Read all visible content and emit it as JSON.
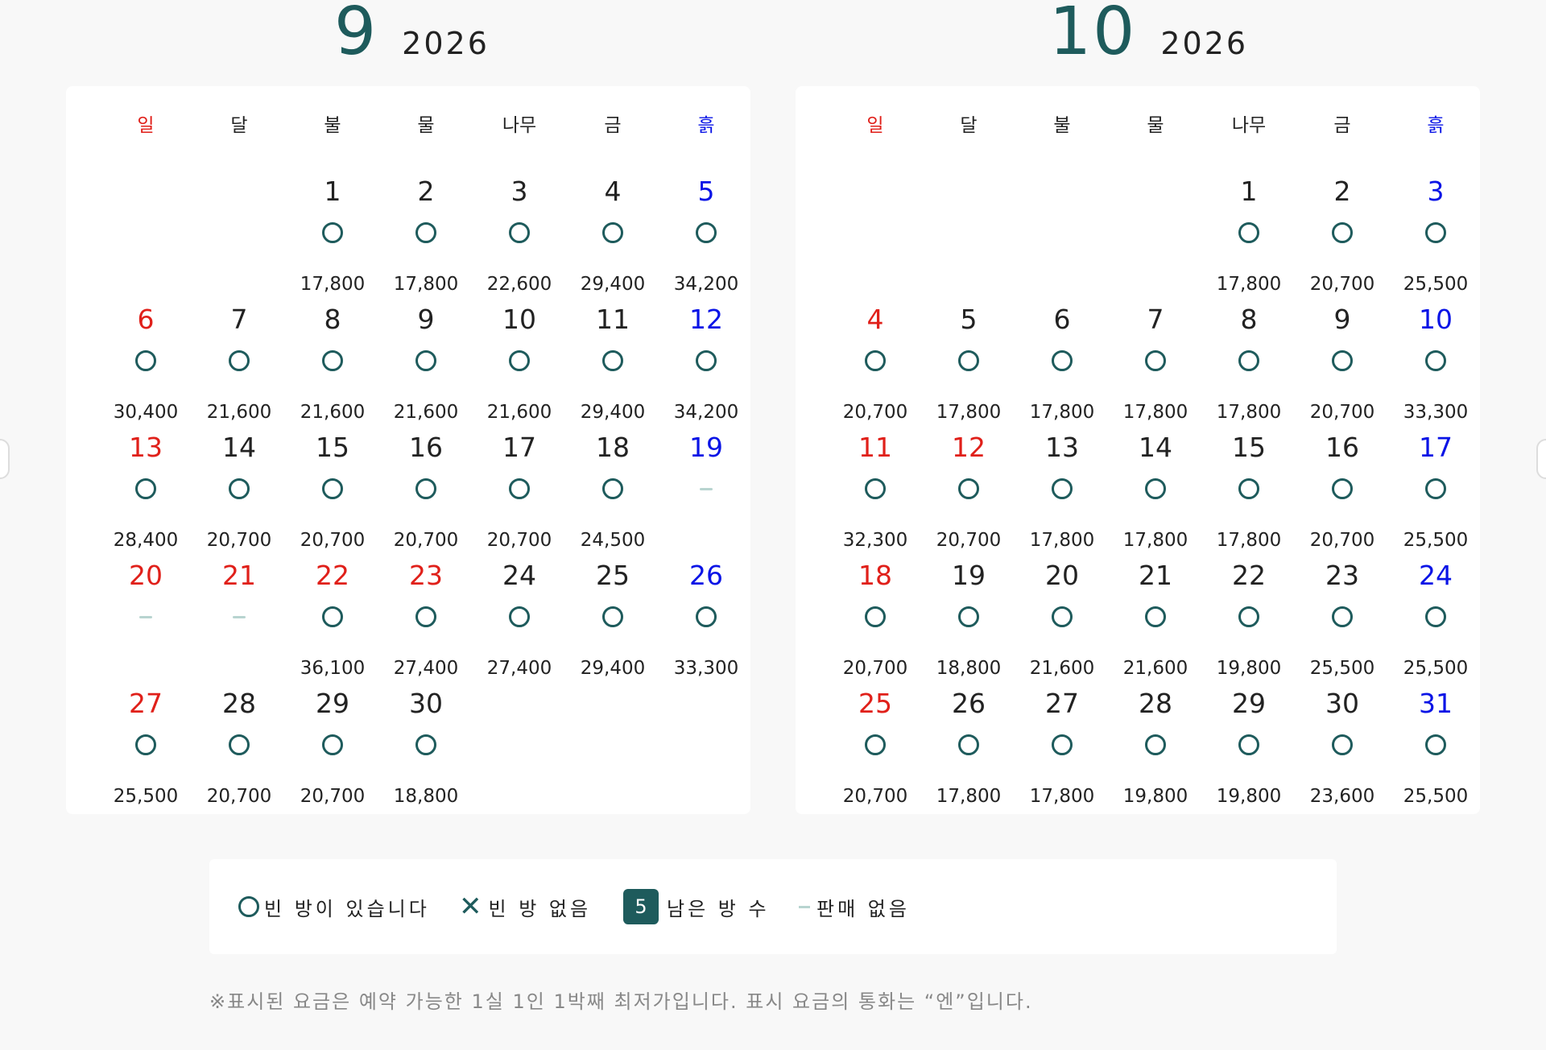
{
  "weekdays": [
    "일",
    "달",
    "불",
    "물",
    "나무",
    "금",
    "흙"
  ],
  "months": [
    {
      "month": "9",
      "year": "2026",
      "days": [
        {
          "d": "1",
          "col": 2,
          "row": 0,
          "c": "n",
          "m": "o",
          "p": "17,800"
        },
        {
          "d": "2",
          "col": 3,
          "row": 0,
          "c": "n",
          "m": "o",
          "p": "17,800"
        },
        {
          "d": "3",
          "col": 4,
          "row": 0,
          "c": "n",
          "m": "o",
          "p": "22,600"
        },
        {
          "d": "4",
          "col": 5,
          "row": 0,
          "c": "n",
          "m": "o",
          "p": "29,400"
        },
        {
          "d": "5",
          "col": 6,
          "row": 0,
          "c": "b",
          "m": "o",
          "p": "34,200"
        },
        {
          "d": "6",
          "col": 0,
          "row": 1,
          "c": "r",
          "m": "o",
          "p": "30,400"
        },
        {
          "d": "7",
          "col": 1,
          "row": 1,
          "c": "n",
          "m": "o",
          "p": "21,600"
        },
        {
          "d": "8",
          "col": 2,
          "row": 1,
          "c": "n",
          "m": "o",
          "p": "21,600"
        },
        {
          "d": "9",
          "col": 3,
          "row": 1,
          "c": "n",
          "m": "o",
          "p": "21,600"
        },
        {
          "d": "10",
          "col": 4,
          "row": 1,
          "c": "n",
          "m": "o",
          "p": "21,600"
        },
        {
          "d": "11",
          "col": 5,
          "row": 1,
          "c": "n",
          "m": "o",
          "p": "29,400"
        },
        {
          "d": "12",
          "col": 6,
          "row": 1,
          "c": "b",
          "m": "o",
          "p": "34,200"
        },
        {
          "d": "13",
          "col": 0,
          "row": 2,
          "c": "r",
          "m": "o",
          "p": "28,400"
        },
        {
          "d": "14",
          "col": 1,
          "row": 2,
          "c": "n",
          "m": "o",
          "p": "20,700"
        },
        {
          "d": "15",
          "col": 2,
          "row": 2,
          "c": "n",
          "m": "o",
          "p": "20,700"
        },
        {
          "d": "16",
          "col": 3,
          "row": 2,
          "c": "n",
          "m": "o",
          "p": "20,700"
        },
        {
          "d": "17",
          "col": 4,
          "row": 2,
          "c": "n",
          "m": "o",
          "p": "20,700"
        },
        {
          "d": "18",
          "col": 5,
          "row": 2,
          "c": "n",
          "m": "o",
          "p": "24,500"
        },
        {
          "d": "19",
          "col": 6,
          "row": 2,
          "c": "b",
          "m": "-",
          "p": ""
        },
        {
          "d": "20",
          "col": 0,
          "row": 3,
          "c": "r",
          "m": "-",
          "p": ""
        },
        {
          "d": "21",
          "col": 1,
          "row": 3,
          "c": "r",
          "m": "-",
          "p": ""
        },
        {
          "d": "22",
          "col": 2,
          "row": 3,
          "c": "r",
          "m": "o",
          "p": "36,100"
        },
        {
          "d": "23",
          "col": 3,
          "row": 3,
          "c": "r",
          "m": "o",
          "p": "27,400"
        },
        {
          "d": "24",
          "col": 4,
          "row": 3,
          "c": "n",
          "m": "o",
          "p": "27,400"
        },
        {
          "d": "25",
          "col": 5,
          "row": 3,
          "c": "n",
          "m": "o",
          "p": "29,400"
        },
        {
          "d": "26",
          "col": 6,
          "row": 3,
          "c": "b",
          "m": "o",
          "p": "33,300"
        },
        {
          "d": "27",
          "col": 0,
          "row": 4,
          "c": "r",
          "m": "o",
          "p": "25,500"
        },
        {
          "d": "28",
          "col": 1,
          "row": 4,
          "c": "n",
          "m": "o",
          "p": "20,700"
        },
        {
          "d": "29",
          "col": 2,
          "row": 4,
          "c": "n",
          "m": "o",
          "p": "20,700"
        },
        {
          "d": "30",
          "col": 3,
          "row": 4,
          "c": "n",
          "m": "o",
          "p": "18,800"
        }
      ]
    },
    {
      "month": "10",
      "year": "2026",
      "days": [
        {
          "d": "1",
          "col": 4,
          "row": 0,
          "c": "n",
          "m": "o",
          "p": "17,800"
        },
        {
          "d": "2",
          "col": 5,
          "row": 0,
          "c": "n",
          "m": "o",
          "p": "20,700"
        },
        {
          "d": "3",
          "col": 6,
          "row": 0,
          "c": "b",
          "m": "o",
          "p": "25,500"
        },
        {
          "d": "4",
          "col": 0,
          "row": 1,
          "c": "r",
          "m": "o",
          "p": "20,700"
        },
        {
          "d": "5",
          "col": 1,
          "row": 1,
          "c": "n",
          "m": "o",
          "p": "17,800"
        },
        {
          "d": "6",
          "col": 2,
          "row": 1,
          "c": "n",
          "m": "o",
          "p": "17,800"
        },
        {
          "d": "7",
          "col": 3,
          "row": 1,
          "c": "n",
          "m": "o",
          "p": "17,800"
        },
        {
          "d": "8",
          "col": 4,
          "row": 1,
          "c": "n",
          "m": "o",
          "p": "17,800"
        },
        {
          "d": "9",
          "col": 5,
          "row": 1,
          "c": "n",
          "m": "o",
          "p": "20,700"
        },
        {
          "d": "10",
          "col": 6,
          "row": 1,
          "c": "b",
          "m": "o",
          "p": "33,300"
        },
        {
          "d": "11",
          "col": 0,
          "row": 2,
          "c": "r",
          "m": "o",
          "p": "32,300"
        },
        {
          "d": "12",
          "col": 1,
          "row": 2,
          "c": "r",
          "m": "o",
          "p": "20,700"
        },
        {
          "d": "13",
          "col": 2,
          "row": 2,
          "c": "n",
          "m": "o",
          "p": "17,800"
        },
        {
          "d": "14",
          "col": 3,
          "row": 2,
          "c": "n",
          "m": "o",
          "p": "17,800"
        },
        {
          "d": "15",
          "col": 4,
          "row": 2,
          "c": "n",
          "m": "o",
          "p": "17,800"
        },
        {
          "d": "16",
          "col": 5,
          "row": 2,
          "c": "n",
          "m": "o",
          "p": "20,700"
        },
        {
          "d": "17",
          "col": 6,
          "row": 2,
          "c": "b",
          "m": "o",
          "p": "25,500"
        },
        {
          "d": "18",
          "col": 0,
          "row": 3,
          "c": "r",
          "m": "o",
          "p": "20,700"
        },
        {
          "d": "19",
          "col": 1,
          "row": 3,
          "c": "n",
          "m": "o",
          "p": "18,800"
        },
        {
          "d": "20",
          "col": 2,
          "row": 3,
          "c": "n",
          "m": "o",
          "p": "21,600"
        },
        {
          "d": "21",
          "col": 3,
          "row": 3,
          "c": "n",
          "m": "o",
          "p": "21,600"
        },
        {
          "d": "22",
          "col": 4,
          "row": 3,
          "c": "n",
          "m": "o",
          "p": "19,800"
        },
        {
          "d": "23",
          "col": 5,
          "row": 3,
          "c": "n",
          "m": "o",
          "p": "25,500"
        },
        {
          "d": "24",
          "col": 6,
          "row": 3,
          "c": "b",
          "m": "o",
          "p": "25,500"
        },
        {
          "d": "25",
          "col": 0,
          "row": 4,
          "c": "r",
          "m": "o",
          "p": "20,700"
        },
        {
          "d": "26",
          "col": 1,
          "row": 4,
          "c": "n",
          "m": "o",
          "p": "17,800"
        },
        {
          "d": "27",
          "col": 2,
          "row": 4,
          "c": "n",
          "m": "o",
          "p": "17,800"
        },
        {
          "d": "28",
          "col": 3,
          "row": 4,
          "c": "n",
          "m": "o",
          "p": "19,800"
        },
        {
          "d": "29",
          "col": 4,
          "row": 4,
          "c": "n",
          "m": "o",
          "p": "19,800"
        },
        {
          "d": "30",
          "col": 5,
          "row": 4,
          "c": "n",
          "m": "o",
          "p": "23,600"
        },
        {
          "d": "31",
          "col": 6,
          "row": 4,
          "c": "b",
          "m": "o",
          "p": "25,500"
        }
      ]
    }
  ],
  "legend": {
    "available": "빈 방이 있습니다",
    "none": "빈 방 없음",
    "badge_num": "5",
    "remaining": "남은 방 수",
    "not_sold": "판매 없음"
  },
  "footnote": "※표시된 요금은 예약 가능한 1실 1인 1박째 최저가입니다. 표시 요금의 통화는 “엔”입니다.",
  "colors": {
    "accent": "#1e5b5c",
    "sunday_holiday": "#e0201a",
    "saturday": "#0a14e6",
    "not_sold_dash": "#b8d4d0"
  },
  "icons": {
    "available": "circle-icon",
    "none": "x-icon",
    "not_sold": "dash-icon"
  }
}
